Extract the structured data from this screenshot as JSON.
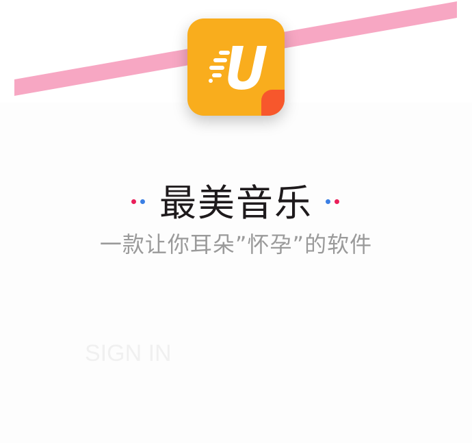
{
  "app": {
    "icon_letter": "U",
    "icon_colors": {
      "background": "#f9ad1d",
      "corner": "#f7572c",
      "glyph": "#ffffff"
    }
  },
  "stripe": {
    "color": "#f7a7c3"
  },
  "header": {
    "title": "最美音乐",
    "subtitle": "一款让你耳朵”怀孕”的软件"
  },
  "decor": {
    "dot_red": "#ea1f5a",
    "dot_blue": "#3b7fe4"
  },
  "actions": {
    "signin_label": "SIGN IN"
  }
}
